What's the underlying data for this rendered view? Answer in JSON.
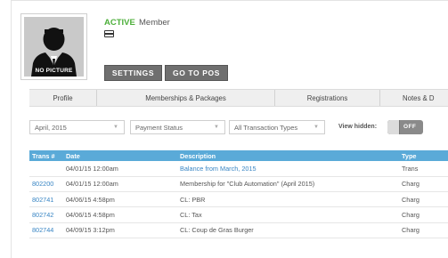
{
  "profile": {
    "no_picture_label": "NO PICTURE",
    "status": "ACTIVE",
    "role": "Member",
    "status_color": "#4caf3a"
  },
  "actions": {
    "settings_label": "SETTINGS",
    "pos_label": "GO TO POS"
  },
  "tabs": [
    "Profile",
    "Memberships & Packages",
    "Registrations",
    "Notes & D"
  ],
  "filters": {
    "period": "April, 2015",
    "payment_status": "Payment Status",
    "transaction_types": "All Transaction Types",
    "view_hidden_label": "View hidden:",
    "toggle_label": "OFF"
  },
  "table": {
    "header_color": "#5aaad8",
    "columns": [
      "Trans #",
      "Date",
      "Description",
      "Type"
    ],
    "rows": [
      {
        "trans": "",
        "date": "04/01/15 12:00am",
        "description": "Balance from March, 2015",
        "type": "Trans"
      },
      {
        "trans": "802200",
        "date": "04/01/15 12:00am",
        "description": "Membership for \"Club Automation\" (April 2015)",
        "type": "Charg"
      },
      {
        "trans": "802741",
        "date": "04/06/15 4:58pm",
        "description": "CL: PBR",
        "type": "Charg"
      },
      {
        "trans": "802742",
        "date": "04/06/15 4:58pm",
        "description": "CL: Tax",
        "type": "Charg"
      },
      {
        "trans": "802744",
        "date": "04/09/15 3:12pm",
        "description": "CL: Coup de Gras Burger",
        "type": "Charg"
      }
    ]
  }
}
